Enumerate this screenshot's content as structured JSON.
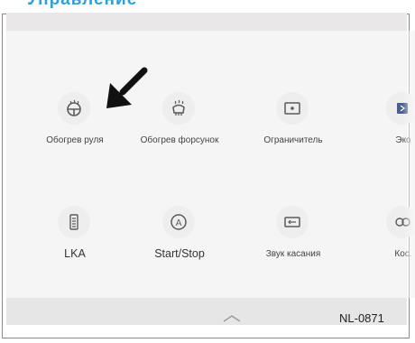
{
  "manual": {
    "heading": "Управление",
    "ref_code": "NL-0871"
  },
  "menu": {
    "row1": [
      {
        "label": "Обогрев руля",
        "icon": "heated-steering-wheel-icon"
      },
      {
        "label": "Обогрев форсунок",
        "icon": "heated-washer-nozzles-icon"
      },
      {
        "label": "Ограничитель",
        "icon": "speed-limiter-icon"
      },
      {
        "label": "Эко",
        "icon": "eco-mode-icon"
      }
    ],
    "row2": [
      {
        "label": "LKA",
        "icon": "lane-keeping-assist-icon"
      },
      {
        "label": "Start/Stop",
        "icon": "start-stop-icon"
      },
      {
        "label": "Звук касания",
        "icon": "touch-sound-icon"
      },
      {
        "label": "Кос.",
        "icon": "partial-tile-icon"
      }
    ]
  },
  "colors": {
    "heading": "#2aa2d8",
    "icon": "#5a5a5a",
    "panel": "#f5f5f5",
    "status_bar": "#e9e7e7"
  }
}
